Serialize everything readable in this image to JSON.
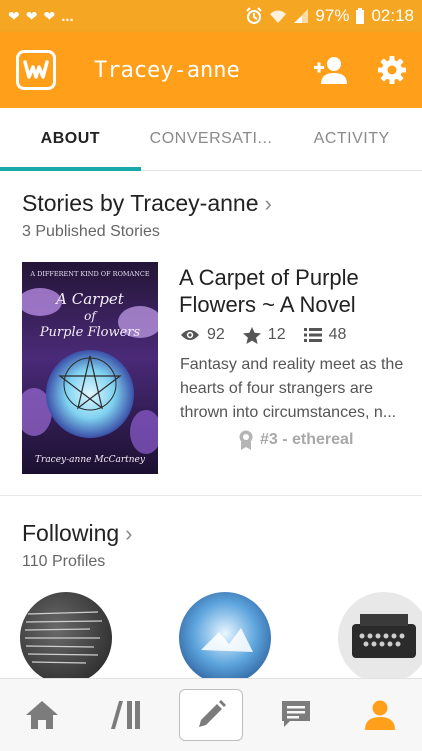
{
  "status_bar": {
    "dots": "...",
    "battery": "97%",
    "time": "02:18"
  },
  "header": {
    "title": "Tracey-anne"
  },
  "tabs": [
    {
      "label": "ABOUT",
      "active": true
    },
    {
      "label": "CONVERSATI...",
      "active": false
    },
    {
      "label": "ACTIVITY",
      "active": false
    }
  ],
  "stories": {
    "title": "Stories by Tracey-anne",
    "subtitle": "3 Published Stories",
    "items": [
      {
        "title": "A Carpet of Purple Flowers ~ A Novel",
        "reads": "92",
        "votes": "12",
        "parts": "48",
        "description": "Fantasy and reality meet as the hearts of four strangers are thrown into circumstances, n...",
        "rank": "#3 - ethereal",
        "cover": {
          "tagline": "A DIFFERENT KIND OF ROMANCE",
          "line1": "A Carpet",
          "line2": "of",
          "line3": "Purple Flowers",
          "author": "Tracey-anne McCartney"
        }
      }
    ]
  },
  "following": {
    "title": "Following",
    "subtitle": "110 Profiles"
  },
  "colors": {
    "orange": "#ff9f1a",
    "status_orange": "#f5a623",
    "teal": "#1aa8a8"
  }
}
